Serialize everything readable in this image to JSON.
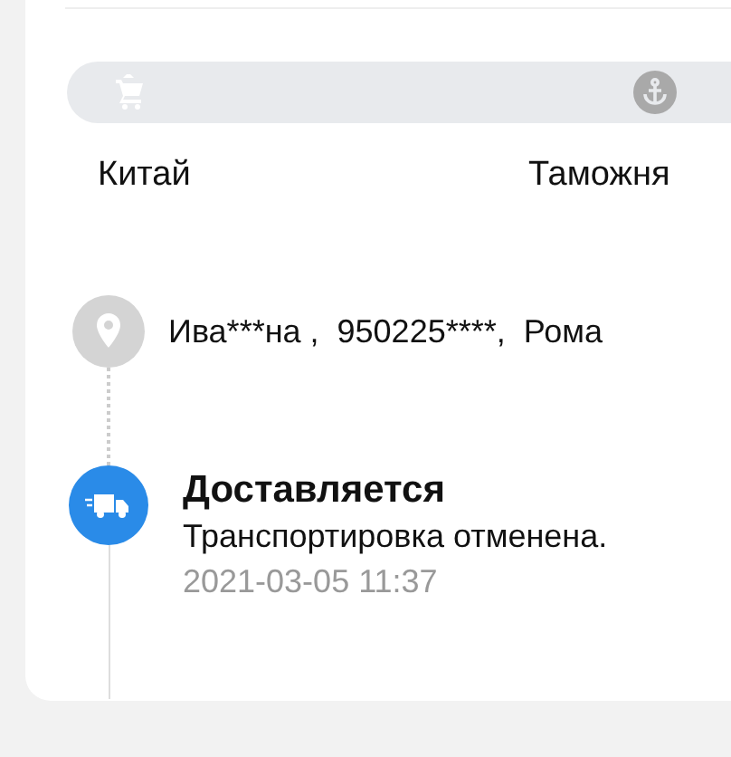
{
  "route": {
    "stops": [
      {
        "label": "Китай",
        "kind": "cart"
      },
      {
        "label": "Таможня",
        "kind": "anchor"
      }
    ]
  },
  "timeline": [
    {
      "kind": "address",
      "text": "Ива***на ,  950225****,  Рома"
    },
    {
      "kind": "status",
      "title": "Доставляется",
      "text": "Транспортировка отменена.",
      "time": "2021-03-05 11:37"
    }
  ]
}
